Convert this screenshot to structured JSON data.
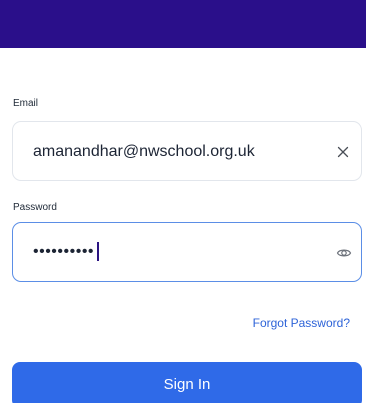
{
  "header": {
    "bar_color": "#2a0f8a"
  },
  "form": {
    "email": {
      "label": "Email",
      "value": "amanandhar@nwschool.org.uk",
      "clear_icon": "close-icon"
    },
    "password": {
      "label": "Password",
      "masked_value": "••••••••••",
      "visibility_icon": "eye-icon"
    },
    "forgot_password_label": "Forgot Password?",
    "sign_in_label": "Sign In"
  },
  "colors": {
    "accent": "#2f6ae8",
    "link": "#2d63d8",
    "focus_border": "#5b8ee6"
  }
}
